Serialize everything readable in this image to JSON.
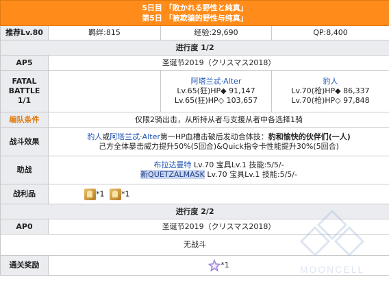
{
  "header": {
    "title_jp": "5日目 「敗かれる野性と純真」",
    "title_cn": "第5日 「被欺骗的野性与纯真」"
  },
  "summary": {
    "recommend_level": "推荐Lv.80",
    "bond": "羁绊:815",
    "exp": "经验:29,690",
    "qp": "QP:8,400"
  },
  "progress1": {
    "label": "进行度 1/2",
    "ap_label": "AP5",
    "event": "圣诞节2019（クリスマス2018）",
    "battle_label_1": "FATAL",
    "battle_label_2": "BATTLE",
    "battle_label_3": "1/1",
    "enemy1": {
      "name": "阿塔兰忒·Alter",
      "hp1": "Lv.65(狂)HP◆ 91,147",
      "hp2": "Lv.65(狂)HP◇ 103,657"
    },
    "enemy2": {
      "name": "豹人",
      "hp1": "Lv.70(枪)HP◆ 86,337",
      "hp2": "Lv.70(枪)HP◇ 97,848"
    },
    "formation_label": "编队条件",
    "formation_text": "仅限2骑出击，从所持从者与支援从者中各选择1骑",
    "effect_label": "战斗效果",
    "effect_line1_a": "豹人",
    "effect_line1_b": "或",
    "effect_line1_c": "阿塔兰忒·Alter",
    "effect_line1_d": "第一HP血槽击破后发动合体技：",
    "effect_line1_e": "豹和愉快的伙伴们(一人)",
    "effect_line2": "己方全体暴击威力提升50%(5回合)&Quick指令卡性能提升30%(5回合)",
    "support_label": "助战",
    "support1_name": "布拉达曼特",
    "support1_rest": " Lv.70 宝具Lv.1 技能:5/5/-",
    "support2_name": "新QUETZALMASK",
    "support2_rest": " Lv.70 宝具Lv.1 技能:5/5/-",
    "drops_label": "战利品",
    "drop1_count": "*1",
    "drop2_count": "*1"
  },
  "progress2": {
    "label": "进行度 2/2",
    "ap_label": "AP0",
    "event": "圣诞节2019（クリスマス2018）",
    "no_battle": "无战斗",
    "reward_label": "通关奖励",
    "reward_count": "*1"
  },
  "watermark": "MOONCELL",
  "colors": {
    "title_bg": "#ff8c1a",
    "header_bg": "#eaecf0",
    "link_blue": "#1f55b5",
    "label_orange": "#e07a10"
  }
}
